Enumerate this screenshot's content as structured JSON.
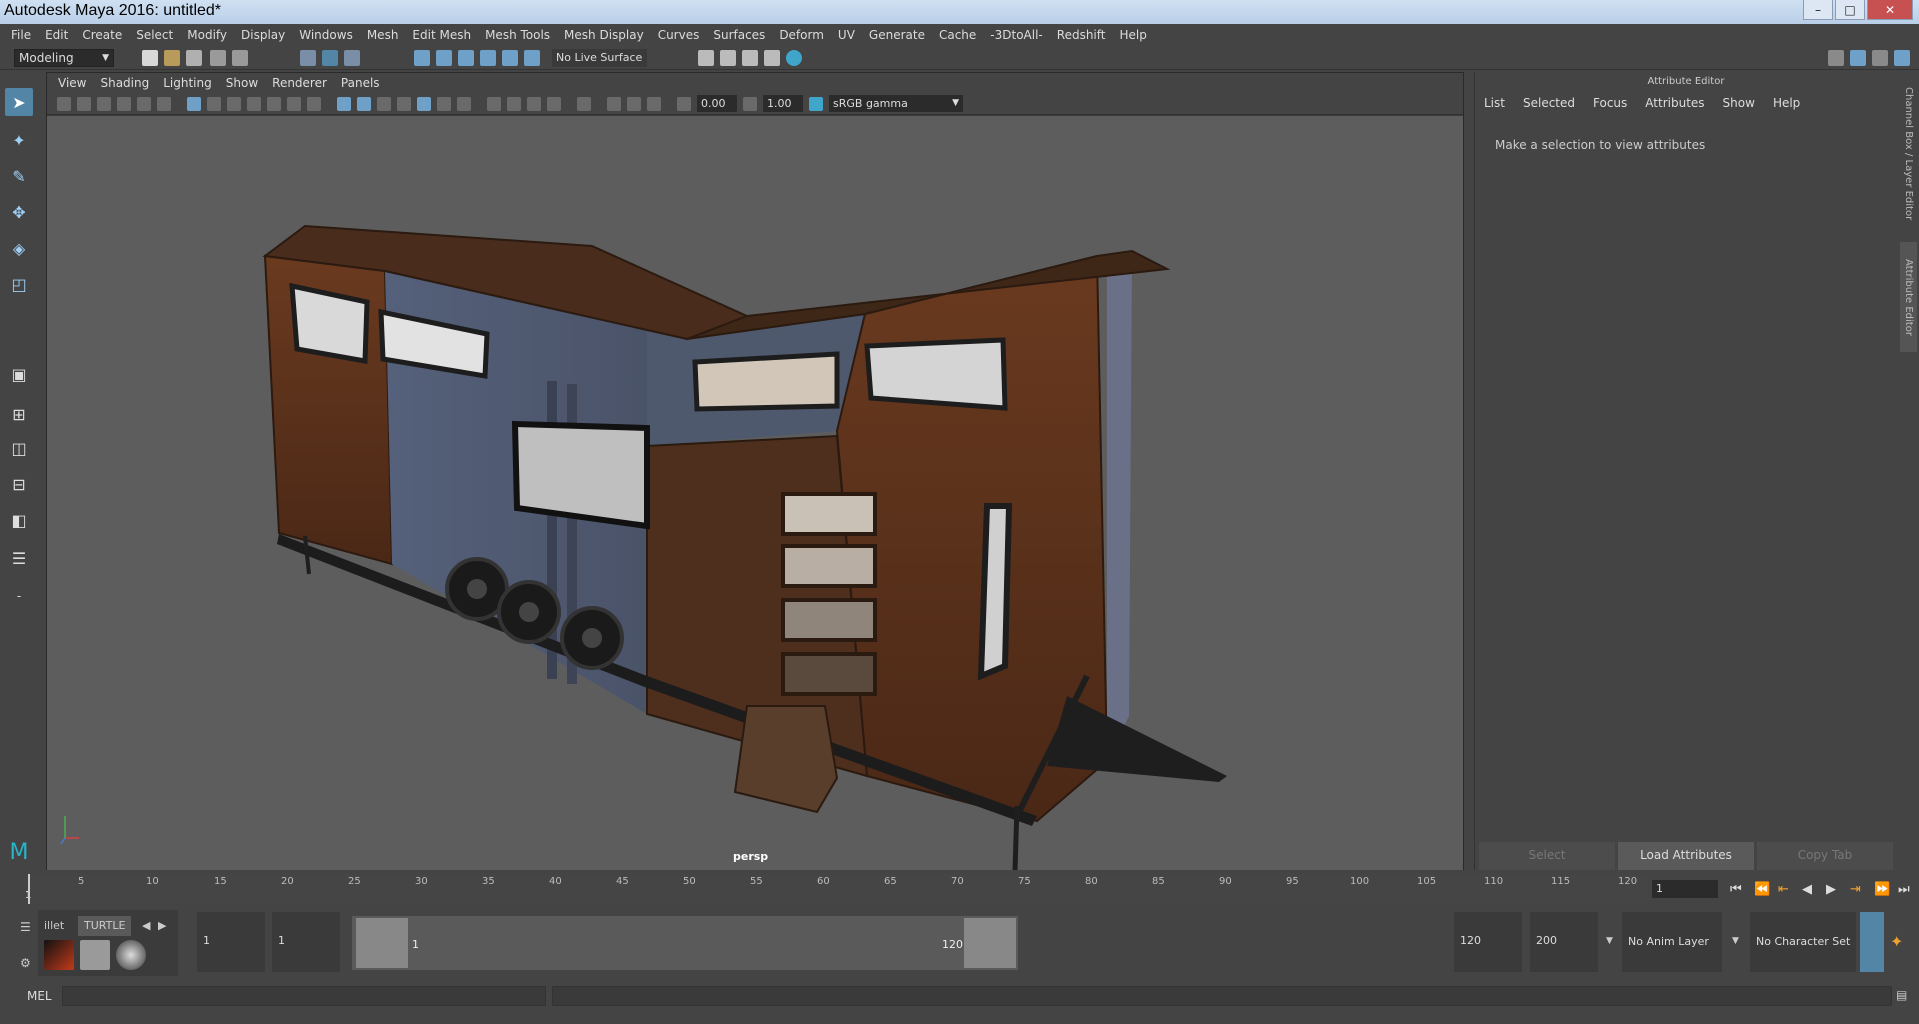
{
  "window": {
    "title": "Autodesk Maya 2016: untitled*",
    "min": "–",
    "max": "□",
    "close": "✕"
  },
  "menu": [
    "File",
    "Edit",
    "Create",
    "Select",
    "Modify",
    "Display",
    "Windows",
    "Mesh",
    "Edit Mesh",
    "Mesh Tools",
    "Mesh Display",
    "Curves",
    "Surfaces",
    "Deform",
    "UV",
    "Generate",
    "Cache",
    "-3DtoAll-",
    "Redshift",
    "Help"
  ],
  "status": {
    "mode": "Modeling",
    "live_surface": "No Live Surface"
  },
  "viewport": {
    "menu": [
      "View",
      "Shading",
      "Lighting",
      "Show",
      "Renderer",
      "Panels"
    ],
    "field_a": "0.00",
    "field_b": "1.00",
    "color_space": "sRGB gamma",
    "camera": "persp"
  },
  "attribute_editor": {
    "title": "Attribute Editor",
    "menu": [
      "List",
      "Selected",
      "Focus",
      "Attributes",
      "Show",
      "Help"
    ],
    "message": "Make a selection to view attributes",
    "buttons": {
      "select": "Select",
      "load": "Load Attributes",
      "copy": "Copy Tab"
    }
  },
  "side_tabs": {
    "channel_box": "Channel Box / Layer Editor",
    "attr_editor": "Attribute Editor"
  },
  "timeline": {
    "ticks": [
      "5",
      "10",
      "15",
      "20",
      "25",
      "30",
      "35",
      "40",
      "45",
      "50",
      "55",
      "60",
      "65",
      "70",
      "75",
      "80",
      "85",
      "90",
      "95",
      "100",
      "105",
      "110",
      "115",
      "120"
    ],
    "start_marker": "1",
    "current_frame": "1"
  },
  "range": {
    "shelf_tabs": [
      "illet",
      "TURTLE"
    ],
    "start": "1",
    "anim_start": "1",
    "slider_start": "1",
    "slider_end": "120",
    "end": "120",
    "anim_end": "200",
    "anim_layer": "No Anim Layer",
    "char_set": "No Character Set"
  },
  "command": {
    "label": "MEL"
  },
  "colors": {
    "accent": "#5285a6",
    "viewport_bg": "#5d5d5d",
    "panel": "#444444"
  }
}
